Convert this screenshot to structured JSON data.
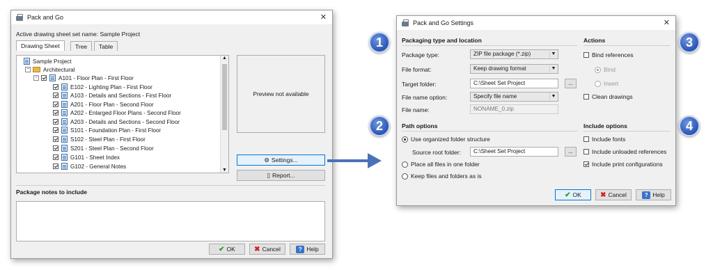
{
  "left_window": {
    "title": "Pack and Go",
    "active_set_label": "Active drawing sheet set name: Sample Project",
    "tabs": [
      "Drawing Sheet",
      "Tree",
      "Table"
    ],
    "tree": {
      "root": "Sample Project",
      "group": "Architectural",
      "items": [
        "A101 - Floor Plan - First Floor",
        "E102 - Lighting Plan - First Floor",
        "A103 - Details and Sections - First Floor",
        "A201 - Floor Plan - Second Floor",
        "A202 - Enlarged Floor Plans - Second Floor",
        "A203 - Details and Sections - Second Floor",
        "S101 - Foundation Plan - First Floor",
        "S102 - Steel Plan - First Floor",
        "S201 - Steel Plan - Second Floor",
        "G101 - Sheet Index",
        "G102 - General Notes"
      ]
    },
    "preview_text": "Preview not available",
    "settings_button": "Settings...",
    "report_button": "Report...",
    "notes_label": "Package notes to include",
    "ok": "OK",
    "cancel": "Cancel",
    "help": "Help"
  },
  "right_window": {
    "title": "Pack and Go Settings",
    "packaging_header": "Packaging type and location",
    "package_type_label": "Package type:",
    "package_type_value": "ZIP file package (*.zip)",
    "file_format_label": "File format:",
    "file_format_value": "Keep drawing format",
    "target_folder_label": "Target folder:",
    "target_folder_value": "C:\\Sheet Set Project",
    "file_name_option_label": "File name option:",
    "file_name_option_value": "Specify file name",
    "file_name_label": "File name:",
    "file_name_value": "NONAME_0.zip",
    "browse": "...",
    "path_header": "Path options",
    "path_organized": "Use organized folder structure",
    "source_root_label": "Source root folder:",
    "source_root_value": "C:\\Sheet Set Project",
    "path_one_folder": "Place all files in one folder",
    "path_as_is": "Keep files and folders as is",
    "actions_header": "Actions",
    "bind_references": "Bind references",
    "bind": "Bind",
    "insert": "Insert",
    "clean_drawings": "Clean drawings",
    "include_header": "Include options",
    "include_fonts": "Include fonts",
    "include_unloaded": "Include unloaded references",
    "include_print": "Include print configurations",
    "ok": "OK",
    "cancel": "Cancel",
    "help": "Help"
  },
  "badges": [
    "1",
    "2",
    "3",
    "4"
  ],
  "colors": {
    "badge": "#2a56b5",
    "arrow": "#4a72b8",
    "focus": "#0078d7"
  }
}
